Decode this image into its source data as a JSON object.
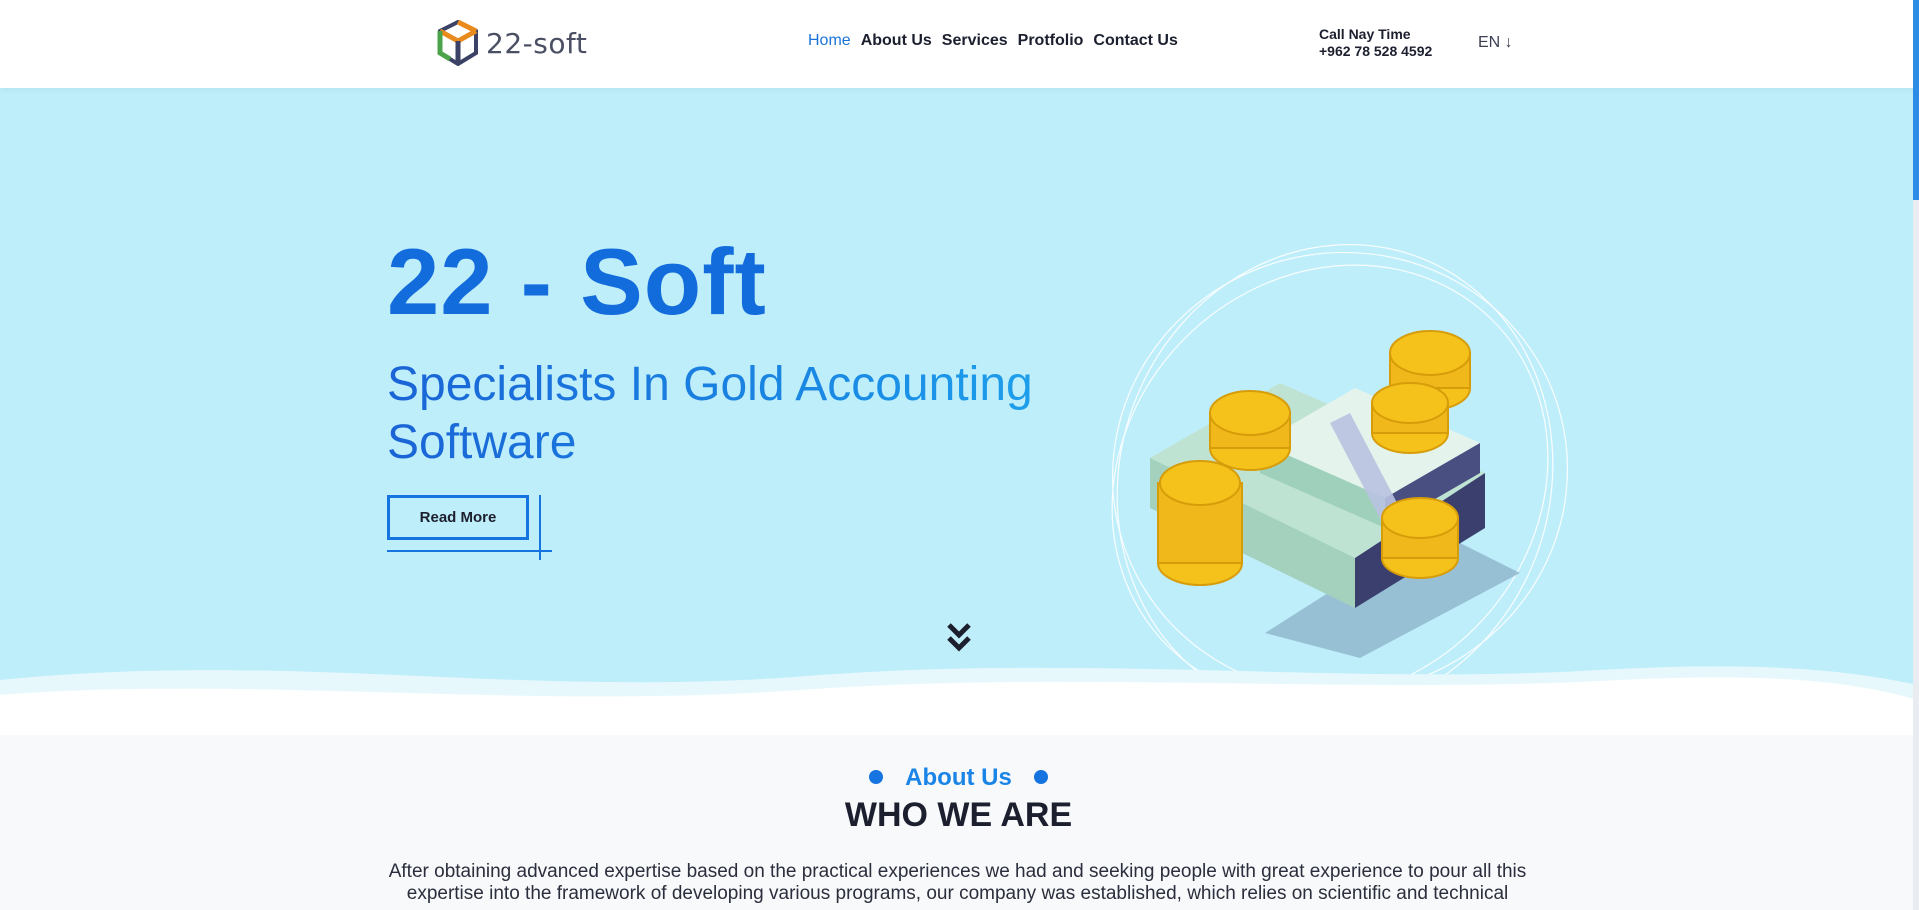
{
  "brand": {
    "logo_text": "22-soft"
  },
  "nav": {
    "items": [
      {
        "label": "Home",
        "active": true
      },
      {
        "label": "About Us",
        "active": false
      },
      {
        "label": "Services",
        "active": false
      },
      {
        "label": "Protfolio",
        "active": false
      },
      {
        "label": "Contact Us",
        "active": false
      }
    ]
  },
  "contact": {
    "call_label": "Call Nay Time",
    "phone": "+962 78 528 4592"
  },
  "language": {
    "label": "EN ↓"
  },
  "hero": {
    "title": "22 - Soft",
    "subtitle": "Specialists In Gold Accounting Software",
    "button_label": "Read More"
  },
  "about": {
    "eyebrow": "About Us",
    "title": "WHO WE ARE",
    "text": "After obtaining advanced expertise based on the practical experiences we had and seeking people with great experience to pour all this expertise into the framework of developing various programs, our company was established, which relies on scientific and technical"
  },
  "colors": {
    "accent": "#1674e0",
    "hero_bg": "#bfeefb",
    "text_dark": "#1c1f2e"
  },
  "icons": {
    "scroll_down": "double-chevron-down-icon",
    "logo": "cube-logo-icon"
  }
}
